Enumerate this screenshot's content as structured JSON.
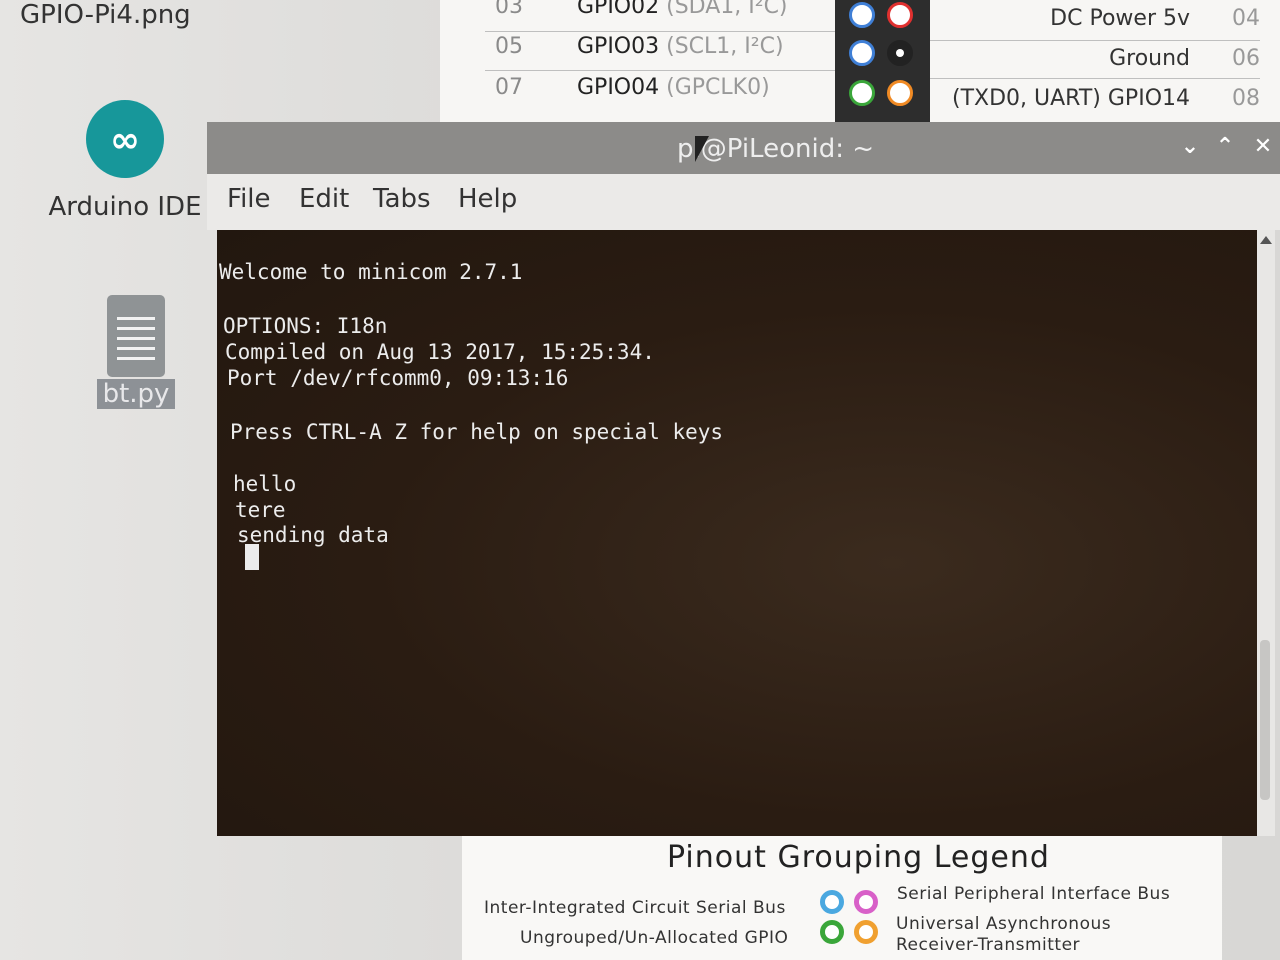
{
  "desktop": {
    "image_filename": "GPIO-Pi4.png",
    "icons": [
      {
        "label": "Arduino IDE",
        "icon": "arduino-icon"
      },
      {
        "label": "bt.py",
        "icon": "text-file-icon"
      }
    ]
  },
  "pinout": {
    "left_rows": [
      {
        "num": "03",
        "name": "GPIO02",
        "extra": "(SDA1, I²C)"
      },
      {
        "num": "05",
        "name": "GPIO03",
        "extra": "(SCL1, I²C)"
      },
      {
        "num": "07",
        "name": "GPIO04",
        "extra": "(GPCLK0)"
      }
    ],
    "right_rows": [
      {
        "label": "DC Power 5v",
        "num": "04"
      },
      {
        "label": "Ground",
        "num": "06"
      },
      {
        "label": "(TXD0, UART) GPIO14",
        "num": "08"
      }
    ],
    "colors": {
      "i2c": "#3f7fd6",
      "power": "#e0302f",
      "ground": "#222222",
      "gpio": "#3aa63a",
      "uart": "#f08a24",
      "spi": "#d860c8"
    },
    "legend": {
      "title": "Pinout Grouping Legend",
      "items": [
        {
          "text": "Inter-Integrated Circuit Serial Bus",
          "color": "#4aa8e0"
        },
        {
          "text": "Serial Peripheral Interface Bus",
          "color": "#d860c8"
        },
        {
          "text": "Ungrouped/Un-Allocated GPIO",
          "color": "#3aa63a"
        },
        {
          "text": "Universal Asynchronous",
          "color": "#f0a030"
        },
        {
          "text": "Receiver-Transmitter",
          "color": ""
        }
      ]
    }
  },
  "terminal": {
    "title": "pi@PiLeonid: ~",
    "menu": [
      "File",
      "Edit",
      "Tabs",
      "Help"
    ],
    "lines": [
      "Welcome to minicom 2.7.1",
      "",
      "OPTIONS: I18n",
      "Compiled on Aug 13 2017, 15:25:34.",
      "Port /dev/rfcomm0, 09:13:16",
      "",
      "Press CTRL-A Z for help on special keys",
      "",
      "hello",
      "tere",
      "sending data"
    ],
    "controls": {
      "minimize": "⌄",
      "maximize": "⌃",
      "close": "✕"
    }
  }
}
